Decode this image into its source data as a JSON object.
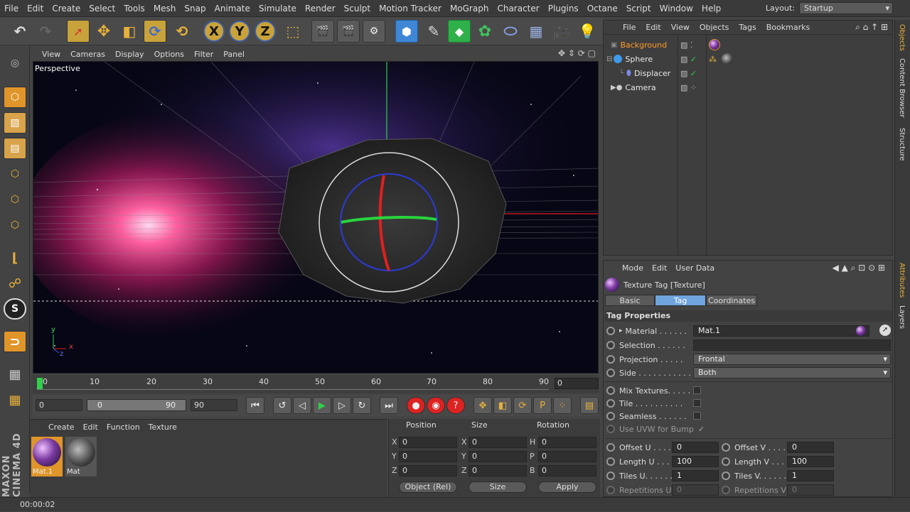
{
  "menubar": {
    "items": [
      "File",
      "Edit",
      "Create",
      "Select",
      "Tools",
      "Mesh",
      "Snap",
      "Animate",
      "Simulate",
      "Render",
      "Sculpt",
      "Motion Tracker",
      "MoGraph",
      "Character",
      "Plugins",
      "Octane",
      "Script",
      "Window",
      "Help"
    ],
    "layout_label": "Layout:",
    "layout_value": "Startup"
  },
  "toolbar": {
    "axis_x": "X",
    "axis_y": "Y",
    "axis_z": "Z"
  },
  "viewport": {
    "menu": [
      "View",
      "Cameras",
      "Display",
      "Options",
      "Filter",
      "Panel"
    ],
    "label": "Perspective",
    "axis_y": "y",
    "axis_z": "z",
    "axis_x": "x"
  },
  "timeline": {
    "ticks": [
      "0",
      "10",
      "20",
      "30",
      "40",
      "50",
      "60",
      "70",
      "80",
      "90"
    ],
    "current_frame": "0"
  },
  "transport": {
    "start_field": "0",
    "range_start": "0",
    "range_end": "90",
    "end_field": "90"
  },
  "material_manager": {
    "menu": [
      "Create",
      "Edit",
      "Function",
      "Texture"
    ],
    "materials": [
      "Mat.1",
      "Mat"
    ]
  },
  "coordinates": {
    "headers": [
      "Position",
      "Size",
      "Rotation"
    ],
    "labels_left": [
      "X",
      "Y",
      "Z"
    ],
    "labels_mid": [
      "X",
      "Y",
      "Z"
    ],
    "labels_right": [
      "H",
      "P",
      "B"
    ],
    "position": [
      "0",
      "0",
      "0"
    ],
    "size": [
      "0",
      "0",
      "0"
    ],
    "rotation": [
      "0",
      "0",
      "0"
    ],
    "mode_dropdown": "Object (Rel)",
    "size_dropdown": "Size",
    "apply_label": "Apply"
  },
  "status": {
    "time": "00:00:02"
  },
  "logo": {
    "text": "MAXON CINEMA 4D"
  },
  "object_manager": {
    "menu": [
      "File",
      "Edit",
      "View",
      "Objects",
      "Tags",
      "Bookmarks"
    ],
    "objects": [
      "Background",
      "Sphere",
      "Displacer",
      "Camera"
    ]
  },
  "attribute_manager": {
    "menu": [
      "Mode",
      "Edit",
      "User Data"
    ],
    "title": "Texture Tag [Texture]",
    "tabs": [
      "Basic",
      "Tag",
      "Coordinates"
    ],
    "section": "Tag Properties",
    "material_label": "Material . . . . . .",
    "material_value": "Mat.1",
    "selection_label": "Selection . . . . . .",
    "projection_label": "Projection . . . . .",
    "projection_value": "Frontal",
    "side_label": "Side . . . . . . . . . . .",
    "side_value": "Both",
    "mix_label": "Mix Textures. . . . .",
    "tile_label": "Tile . . . . . . . . . .",
    "seamless_label": "Seamless . . . . . .",
    "uvw_label": "Use UVW for Bump",
    "offset_u_label": "Offset U . . . .",
    "offset_u": "0",
    "offset_v_label": "Offset V . . . .",
    "offset_v": "0",
    "length_u_label": "Length U . . . .",
    "length_u": "100",
    "length_v_label": "Length V . . . .",
    "length_v": "100",
    "tiles_u_label": "Tiles U. . . . . .",
    "tiles_u": "1",
    "tiles_v_label": "Tiles V. . . . . .",
    "tiles_v": "1",
    "rep_u_label": "Repetitions U",
    "rep_u": "0",
    "rep_v_label": "Repetitions V",
    "rep_v": "0"
  },
  "right_strip": {
    "tabs": [
      "Objects",
      "Content Browser",
      "Structure",
      "Attributes",
      "Layers"
    ]
  }
}
